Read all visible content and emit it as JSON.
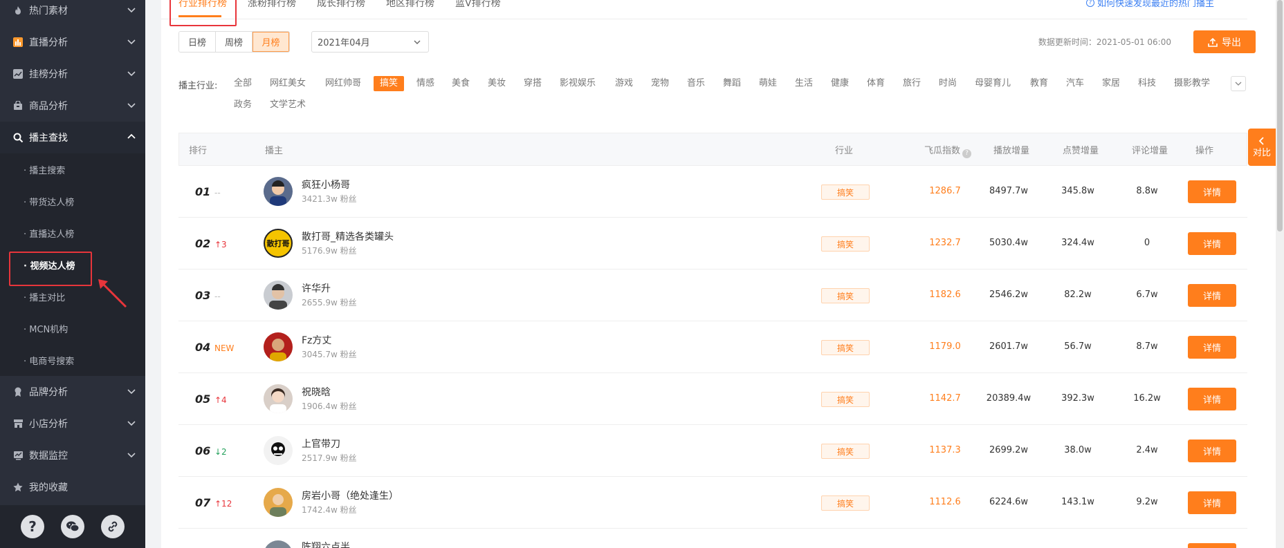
{
  "sidebar": {
    "items": [
      {
        "label": "热门素材",
        "icon": "fire-icon"
      },
      {
        "label": "直播分析",
        "icon": "bar-chart-icon"
      },
      {
        "label": "挂榜分析",
        "icon": "line-chart-icon"
      },
      {
        "label": "商品分析",
        "icon": "bag-icon"
      },
      {
        "label": "播主查找",
        "icon": "search-icon"
      },
      {
        "label": "品牌分析",
        "icon": "medal-icon"
      },
      {
        "label": "小店分析",
        "icon": "store-icon"
      },
      {
        "label": "数据监控",
        "icon": "monitor-icon"
      },
      {
        "label": "我的收藏",
        "icon": "star-icon"
      }
    ],
    "sub_items": [
      "· 播主搜索",
      "· 带货达人榜",
      "· 直播达人榜",
      "· 视频达人榜",
      "· 播主对比",
      "· MCN机构",
      "· 电商号搜索"
    ],
    "bottom_icons": [
      "help-icon",
      "wechat-icon",
      "link-icon"
    ],
    "help_glyph": "?"
  },
  "tabs": [
    "行业排行榜",
    "涨粉排行榜",
    "成长排行榜",
    "地区排行榜",
    "蓝V排行榜"
  ],
  "help_link": "如何快速发现最近的热门播主",
  "period": {
    "options": [
      "日榜",
      "周榜",
      "月榜"
    ],
    "selected": "月榜"
  },
  "month_select": "2021年04月",
  "update_time": "数据更新时间：2021-05-01 06:00",
  "export_label": "导出",
  "industry": {
    "label": "播主行业:",
    "options": [
      "全部",
      "网红美女",
      "网红帅哥",
      "搞笑",
      "情感",
      "美食",
      "美妆",
      "穿搭",
      "影视娱乐",
      "游戏",
      "宠物",
      "音乐",
      "舞蹈",
      "萌娃",
      "生活",
      "健康",
      "体育",
      "旅行",
      "时尚",
      "母婴育儿",
      "教育",
      "汽车",
      "家居",
      "科技",
      "摄影教学",
      "政务",
      "文学艺术"
    ],
    "selected": "搞笑"
  },
  "table": {
    "headers": {
      "rank": "排行",
      "streamer": "播主",
      "industry": "行业",
      "score": "飞瓜指数",
      "play": "播放增量",
      "like": "点赞增量",
      "comment": "评论增量",
      "action": "操作"
    },
    "detail_label": "详情",
    "rows": [
      {
        "rank": "01",
        "trend": "--",
        "trend_type": "flat",
        "name": "疯狂小杨哥",
        "fans": "3421.3w 粉丝",
        "industry": "搞笑",
        "score": "1286.7",
        "play": "8497.7w",
        "like": "345.8w",
        "comment": "8.8w",
        "avatar_color": "#5a6b8c"
      },
      {
        "rank": "02",
        "trend": "↑3",
        "trend_type": "up",
        "name": "散打哥_精选各类罐头",
        "fans": "5176.9w 粉丝",
        "industry": "搞笑",
        "score": "1232.7",
        "play": "5030.4w",
        "like": "324.4w",
        "comment": "0",
        "avatar_color": "#f5c400",
        "avatar_text": "散打哥"
      },
      {
        "rank": "03",
        "trend": "--",
        "trend_type": "flat",
        "name": "许华升",
        "fans": "2655.9w 粉丝",
        "industry": "搞笑",
        "score": "1182.6",
        "play": "2546.2w",
        "like": "82.2w",
        "comment": "6.7w",
        "avatar_color": "#8a8f99"
      },
      {
        "rank": "04",
        "trend": "NEW",
        "trend_type": "new",
        "name": "Fz方丈",
        "fans": "3045.7w 粉丝",
        "industry": "搞笑",
        "score": "1179.0",
        "play": "2601.7w",
        "like": "56.7w",
        "comment": "8.7w",
        "avatar_color": "#b3201c"
      },
      {
        "rank": "05",
        "trend": "↑4",
        "trend_type": "up",
        "name": "祝晓晗",
        "fans": "1906.4w 粉丝",
        "industry": "搞笑",
        "score": "1142.7",
        "play": "20389.4w",
        "like": "392.3w",
        "comment": "16.2w",
        "avatar_color": "#d9cfc8"
      },
      {
        "rank": "06",
        "trend": "↓2",
        "trend_type": "down",
        "name": "上官带刀",
        "fans": "2517.9w 粉丝",
        "industry": "搞笑",
        "score": "1137.3",
        "play": "2699.2w",
        "like": "38.0w",
        "comment": "2.4w",
        "avatar_color": "#f2f2f2"
      },
      {
        "rank": "07",
        "trend": "↑12",
        "trend_type": "up",
        "name": "房岩小哥（绝处逢生）",
        "fans": "1742.4w 粉丝",
        "industry": "搞笑",
        "score": "1112.6",
        "play": "6224.6w",
        "like": "143.1w",
        "comment": "9.2w",
        "avatar_color": "#e6a94a"
      },
      {
        "rank": "",
        "trend": "",
        "trend_type": "flat",
        "name": "陈翔六点半",
        "fans": "",
        "industry": "",
        "score": "",
        "play": "",
        "like": "",
        "comment": "",
        "avatar_color": "#7b8794"
      }
    ]
  },
  "compare_label": "对比",
  "colors": {
    "accent": "#ff7e1c",
    "sidebar": "#2b2f3a",
    "annotation": "#e8353b",
    "link": "#3b7ff2"
  }
}
